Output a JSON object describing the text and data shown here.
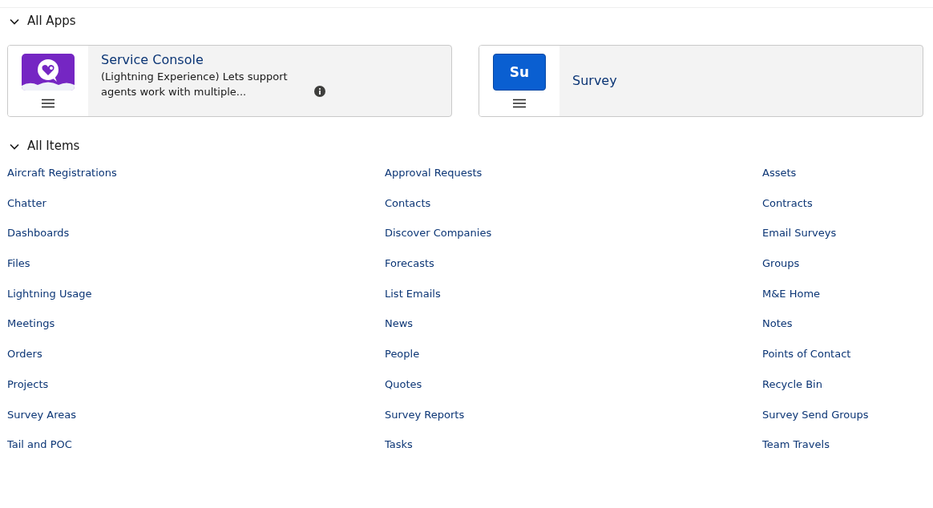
{
  "apps_section": {
    "title": "All Apps",
    "expanded": true,
    "apps": [
      {
        "kind": "picture_icon",
        "name": "Service Console",
        "description": "(Lightning Experience) Lets support agents work with multiple..."
      },
      {
        "kind": "initials",
        "initials": "Su",
        "name": "Survey"
      }
    ]
  },
  "items_section": {
    "title": "All Items",
    "expanded": true,
    "items": [
      "Aircraft Registrations",
      "Approval Requests",
      "Assets",
      "Chatter",
      "Contacts",
      "Contracts",
      "Dashboards",
      "Discover Companies",
      "Email Surveys",
      "Files",
      "Forecasts",
      "Groups",
      "Lightning Usage",
      "List Emails",
      "M&E Home",
      "Meetings",
      "News",
      "Notes",
      "Orders",
      "People",
      "Points of Contact",
      "Projects",
      "Quotes",
      "Recycle Bin",
      "Survey Areas",
      "Survey Reports",
      "Survey Send Groups",
      "Tail and POC",
      "Tasks",
      "Team Travels"
    ]
  }
}
